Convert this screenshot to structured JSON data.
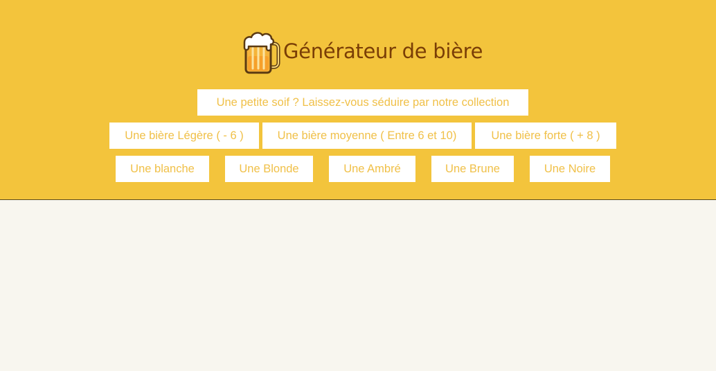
{
  "header": {
    "title": "Générateur de bière",
    "logo_icon": "beer-mug-icon",
    "background_color": "#f3c43c",
    "title_color": "#7a3e06",
    "button_text_color": "#f0c048"
  },
  "buttons": {
    "collection": "Une petite soif ? Laissez-vous séduire par notre collection",
    "strength": {
      "light": "Une bière Légère ( - 6 )",
      "medium": "Une bière moyenne ( Entre 6 et 10)",
      "strong": "Une bière forte ( + 8 )"
    },
    "types": {
      "blanche": "Une blanche",
      "blonde": "Une Blonde",
      "ambree": "Une Ambré",
      "brune": "Une Brune",
      "noire": "Une Noire"
    }
  }
}
